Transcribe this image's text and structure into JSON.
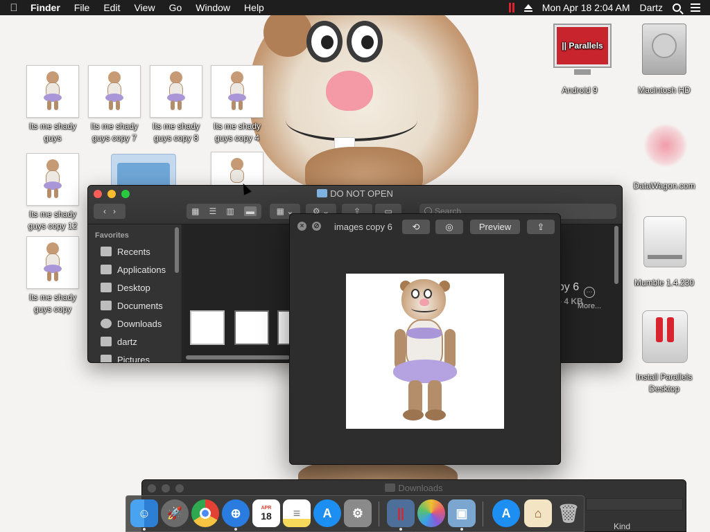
{
  "menubar": {
    "apple": "",
    "app_name": "Finder",
    "items": [
      "File",
      "Edit",
      "View",
      "Go",
      "Window",
      "Help"
    ],
    "datetime": "Mon Apr 18  2:04 AM",
    "user": "Dartz"
  },
  "desktop_left": [
    {
      "label": "Its me shady guys"
    },
    {
      "label": "Its me shady guys copy 7"
    },
    {
      "label": "Its me shady guys copy 8"
    },
    {
      "label": "Its me shady guys copy 4"
    },
    {
      "label": "Its me shady guys copy 12"
    },
    {
      "label": "Its me shady guys copy"
    }
  ],
  "desktop_right": [
    {
      "label": "Android 9",
      "icon": "parallels-vm-icon",
      "badge": "|| Parallels"
    },
    {
      "label": "Macintosh HD",
      "icon": "hard-drive-icon"
    },
    {
      "label": "DataWagon.com",
      "icon": "pink-scatter-icon"
    },
    {
      "label": "Mumble 1.4.230",
      "icon": "disk-image-icon"
    },
    {
      "label": "Install Parallels Desktop",
      "icon": "parallels-installer-icon"
    }
  ],
  "finder": {
    "title": "DO NOT OPEN",
    "search_placeholder": "Search",
    "sidebar": {
      "heading": "Favorites",
      "items": [
        "Recents",
        "Applications",
        "Desktop",
        "Documents",
        "Downloads",
        "dartz",
        "Pictures"
      ]
    },
    "info_title": "opy 6",
    "info_sub": "e - 4 KB",
    "info_more": "More..."
  },
  "quicklook": {
    "title": "images copy 6",
    "preview_button": "Preview"
  },
  "downloads_window": {
    "title": "Downloads",
    "kind_header": "Kind"
  },
  "dock": {
    "calendar_month": "APR",
    "calendar_day": "18"
  },
  "colors": {
    "menubar_bg": "#1e1e1e",
    "window_bg": "#2a2a2a",
    "parallels_red": "#d9232e",
    "traffic_red": "#fc5f57",
    "traffic_yellow": "#fdbc2e",
    "traffic_green": "#28c840"
  }
}
